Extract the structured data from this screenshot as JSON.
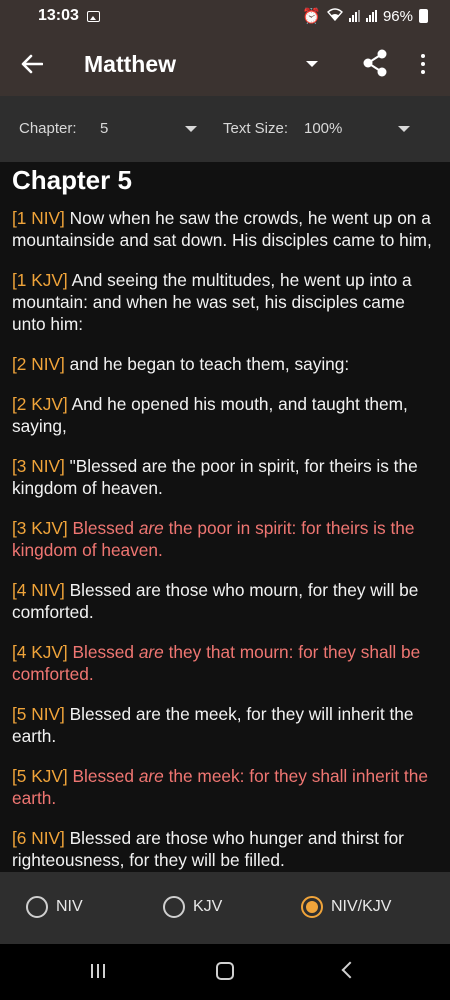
{
  "status": {
    "time": "13:03",
    "battery": "96%"
  },
  "app_bar": {
    "title": "Matthew"
  },
  "options": {
    "chapter_label": "Chapter:",
    "chapter_value": "5",
    "text_size_label": "Text Size:",
    "text_size_value": "100%"
  },
  "content": {
    "chapter_title": "Chapter 5",
    "verses": [
      {
        "ref": "[1 NIV]",
        "text": " Now when he saw the crowds, he went up on a mountainside and sat down. His disciples came to him,"
      },
      {
        "ref": "[1 KJV]",
        "text": " And seeing the multitudes, he went up into a mountain: and when he was set, his disciples came unto him:"
      },
      {
        "ref": "[2 NIV]",
        "text": " and he began to teach them, saying:"
      },
      {
        "ref": "[2 KJV]",
        "text": " And he opened his mouth, and taught them, saying,"
      },
      {
        "ref": "[3 NIV]",
        "text": " \"Blessed are the poor in spirit, for theirs is the kingdom of heaven."
      },
      {
        "ref": "[3 KJV]",
        "pre": " Blessed ",
        "em": "are",
        "post": " the poor in spirit: for theirs is the kingdom of heaven."
      },
      {
        "ref": "[4 NIV]",
        "text": " Blessed are those who mourn, for they will be comforted."
      },
      {
        "ref": "[4 KJV]",
        "pre": " Blessed ",
        "em": "are",
        "post": " they that mourn: for they shall be comforted."
      },
      {
        "ref": "[5 NIV]",
        "text": " Blessed are the meek, for they will inherit the earth."
      },
      {
        "ref": "[5 KJV]",
        "pre": " Blessed ",
        "em": "are",
        "post": " the meek: for they shall inherit the earth."
      },
      {
        "ref": "[6 NIV]",
        "text": " Blessed are those who hunger and thirst for righteousness, for they will be filled."
      }
    ]
  },
  "version_options": [
    {
      "label": "NIV",
      "selected": false
    },
    {
      "label": "KJV",
      "selected": false
    },
    {
      "label": "NIV/KJV",
      "selected": true
    }
  ],
  "colors": {
    "accent": "#f0a43a",
    "kjv_text": "#ef7672",
    "app_bar": "#3b3330",
    "panel": "#2e2e2e"
  },
  "icons": [
    "image-icon",
    "alarm-icon",
    "wifi-icon",
    "signal-icon",
    "battery-icon",
    "back-arrow-icon",
    "dropdown-icon",
    "share-icon",
    "more-vert-icon",
    "recent-apps-icon",
    "home-icon",
    "nav-back-icon"
  ]
}
